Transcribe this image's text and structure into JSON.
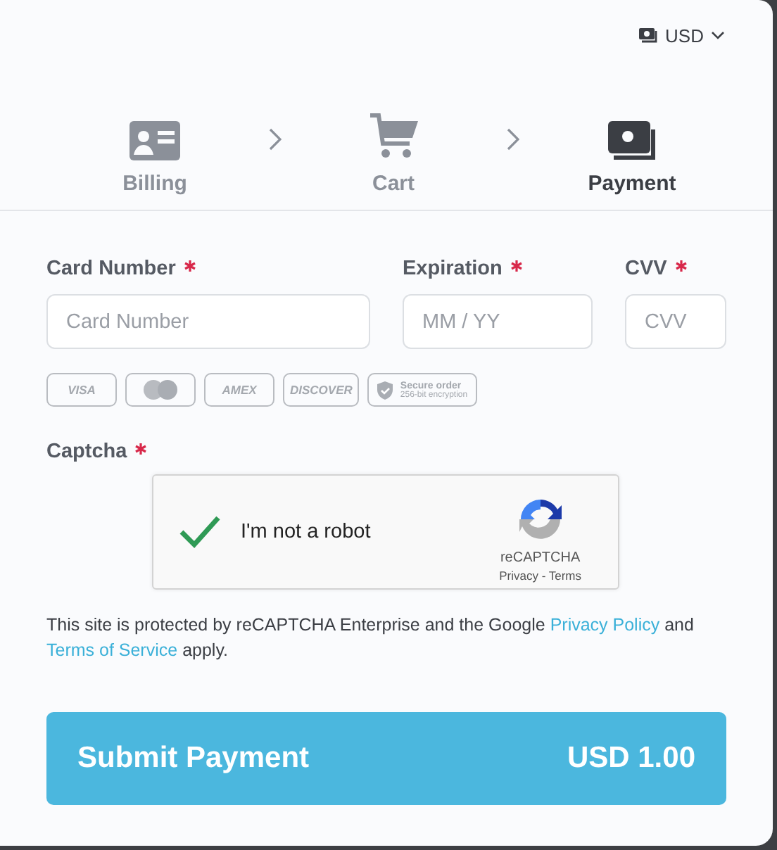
{
  "currency": {
    "label": "USD"
  },
  "steps": [
    {
      "label": "Billing",
      "selected": false
    },
    {
      "label": "Cart",
      "selected": false
    },
    {
      "label": "Payment",
      "selected": true
    }
  ],
  "fields": [
    {
      "label": "Card Number",
      "required": true,
      "placeholder": "Card Number"
    },
    {
      "label": "Expiration",
      "required": true,
      "placeholder": "MM / YY"
    },
    {
      "label": "CVV",
      "required": true,
      "placeholder": "CVV"
    }
  ],
  "badges": [
    {
      "kind": "text",
      "text": "VISA"
    },
    {
      "kind": "mastercard"
    },
    {
      "kind": "text",
      "text": "AMEX"
    },
    {
      "kind": "text",
      "text": "DISCOVER"
    },
    {
      "kind": "secure",
      "title": "Secure order",
      "subtitle": "256-bit encryption"
    }
  ],
  "captcha": {
    "label": "Captcha",
    "required": true,
    "text": "I'm not a robot",
    "checked": true,
    "brand": "reCAPTCHA",
    "links": "Privacy - Terms"
  },
  "legal": [
    {
      "kind": "text",
      "text": "This site is protected by reCAPTCHA Enterprise and the Google "
    },
    {
      "kind": "link",
      "text": "Privacy Policy"
    },
    {
      "kind": "text",
      "text": " and "
    },
    {
      "kind": "link",
      "text": "Terms of Service"
    },
    {
      "kind": "text",
      "text": " apply."
    }
  ],
  "submit": {
    "label": "Submit Payment",
    "amount": "USD 1.00"
  }
}
